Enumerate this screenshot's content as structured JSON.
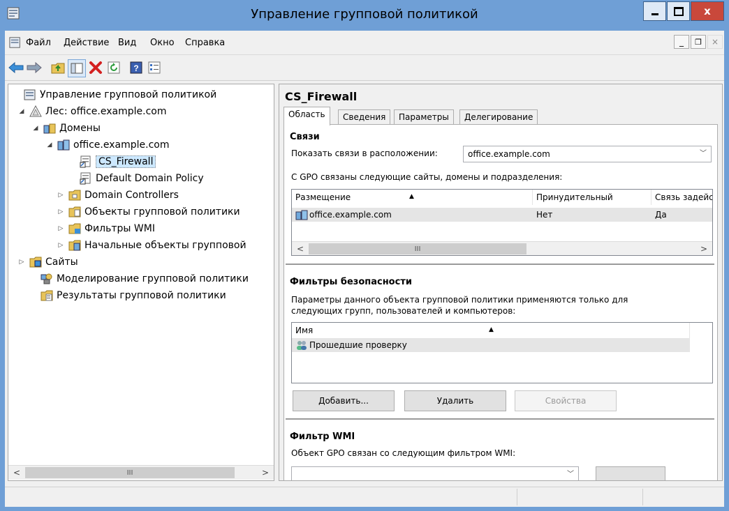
{
  "window": {
    "title": "Управление групповой политикой",
    "min": "‒",
    "max": "□",
    "close": "x"
  },
  "menu": {
    "items": [
      "Файл",
      "Действие",
      "Вид",
      "Окно",
      "Справка"
    ],
    "mdi_min": "_",
    "mdi_restore": "ₐ",
    "mdi_close": "×"
  },
  "toolbar": {
    "icons": [
      "back-arrow-icon",
      "forward-arrow-icon",
      "folder-up-icon",
      "show-hide-tree-icon",
      "delete-icon",
      "refresh-icon",
      "help-icon",
      "properties-icon"
    ]
  },
  "tree": {
    "items": [
      {
        "label": "Управление групповой политикой",
        "icon": "gpm-root-icon",
        "expander": ""
      },
      {
        "label": "Лес: office.example.com",
        "icon": "forest-icon",
        "expander": "◢"
      },
      {
        "label": "Домены",
        "icon": "domains-icon",
        "expander": "◢"
      },
      {
        "label": "office.example.com",
        "icon": "domain-icon",
        "expander": "◢"
      },
      {
        "label": "CS_Firewall",
        "icon": "gpo-link-icon",
        "expander": ""
      },
      {
        "label": "Default Domain Policy",
        "icon": "gpo-link-icon",
        "expander": ""
      },
      {
        "label": "Domain Controllers",
        "icon": "ou-folder-icon",
        "expander": "▷"
      },
      {
        "label": "Объекты групповой политики",
        "icon": "gpo-folder-icon",
        "expander": "▷"
      },
      {
        "label": "Фильтры WMI",
        "icon": "wmi-folder-icon",
        "expander": "▷"
      },
      {
        "label": "Начальные объекты групповой",
        "icon": "starter-gpo-folder-icon",
        "expander": "▷"
      },
      {
        "label": "Сайты",
        "icon": "sites-icon",
        "expander": "▷"
      },
      {
        "label": "Моделирование групповой политики",
        "icon": "modeling-icon",
        "expander": ""
      },
      {
        "label": "Результаты групповой политики",
        "icon": "results-icon",
        "expander": ""
      }
    ],
    "selected_index": 4,
    "scroll_thumb": "III"
  },
  "right": {
    "gpo_title": "CS_Firewall",
    "tabs": [
      "Область",
      "Сведения",
      "Параметры",
      "Делегирование"
    ],
    "active_tab": 0,
    "links": {
      "heading": "Связи",
      "show_links_label": "Показать связи в расположении:",
      "location_value": "office.example.com",
      "linked_text": "С GPO связаны следующие сайты, домены и подразделения:",
      "columns": [
        "Размещение",
        "Принудительный",
        "Связь задействована"
      ],
      "rows": [
        {
          "location": "office.example.com",
          "enforced": "Нет",
          "enabled": "Да"
        }
      ],
      "scroll_thumb": "III"
    },
    "security": {
      "heading": "Фильтры безопасности",
      "description_line1": "Параметры данного объекта групповой политики применяются только для",
      "description_line2": "следующих групп, пользователей и компьютеров:",
      "columns": [
        "Имя"
      ],
      "rows": [
        {
          "name": "Прошедшие проверку"
        }
      ],
      "add_label": "Добавить...",
      "remove_label": "Удалить",
      "properties_label": "Свойства"
    },
    "wmi": {
      "heading": "Фильтр WMI",
      "text": "Объект GPO связан со следующим фильтром WMI:"
    }
  },
  "colors": {
    "titlebar": "#6f9fd6",
    "close": "#c9483b",
    "selection": "#cce8ff"
  }
}
